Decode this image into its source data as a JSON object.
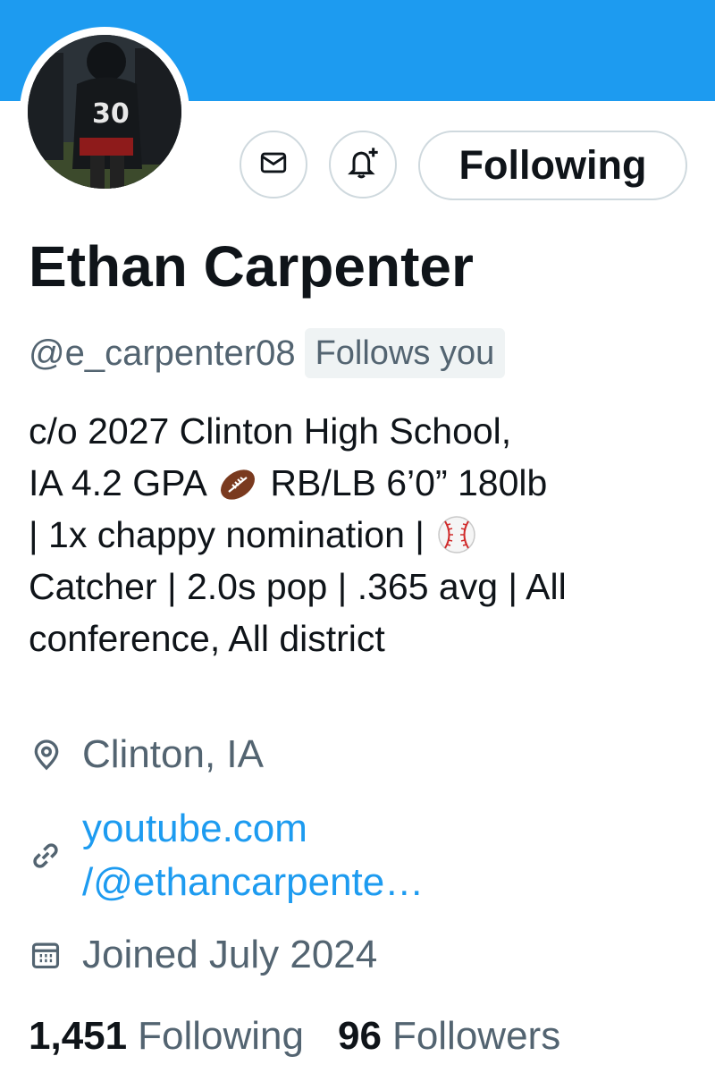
{
  "colors": {
    "banner": "#1d9bf0",
    "link": "#1d9bf0",
    "secondary_text": "#536471",
    "primary_text": "#0f1419",
    "border": "#cfd9de"
  },
  "header": {
    "avatar_jersey_number": "30"
  },
  "actions": {
    "message_icon": "mail-icon",
    "notify_icon": "bell-plus-icon",
    "follow_label": "Following"
  },
  "profile": {
    "name": "Ethan Carpenter",
    "handle": "@e_carpenter08",
    "follows_you": "Follows you",
    "bio_lines": [
      {
        "a": "c/o 2027 Clinton High School,",
        "b": ""
      },
      {
        "a": "IA 4.2 GPA",
        "b": "RB/LB 6’0” 180lb"
      },
      {
        "a": "| 1x chappy nomination |",
        "b": ""
      },
      {
        "a": "Catcher | 2.0s pop | .365 avg | All",
        "b": ""
      },
      {
        "a": "conference, All district",
        "b": ""
      }
    ],
    "bio_emojis": [
      "football-emoji",
      "baseball-emoji"
    ],
    "location": "Clinton, IA",
    "website_line1": "youtube.com",
    "website_line2": "/@ethancarpente…",
    "joined": "Joined July 2024"
  },
  "stats": {
    "following_count": "1,451",
    "following_label": "Following",
    "followers_count": "96",
    "followers_label": "Followers"
  }
}
